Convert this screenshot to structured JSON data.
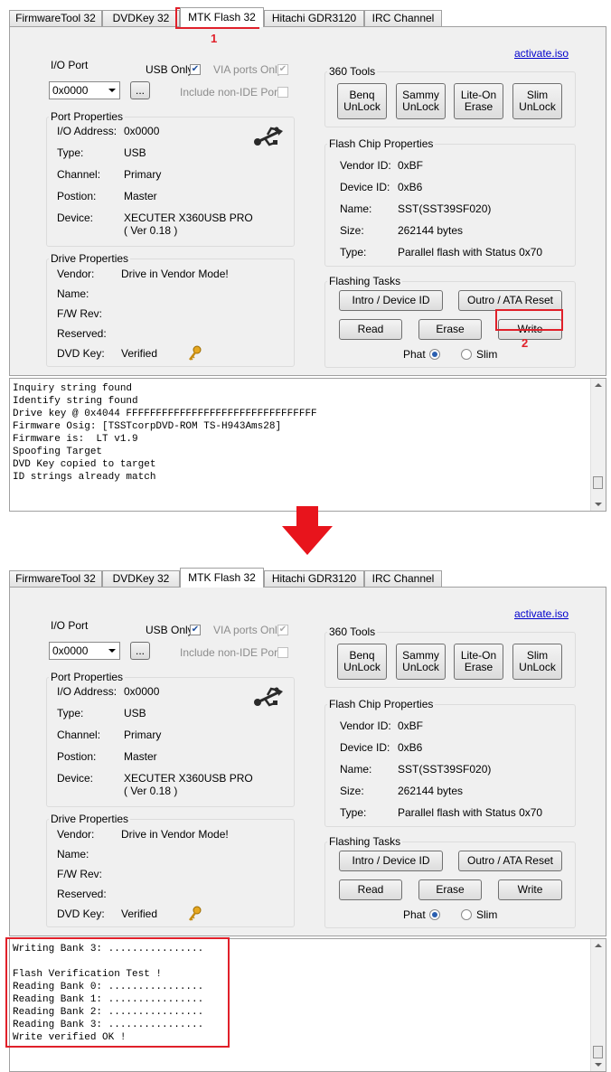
{
  "tabs": [
    "FirmwareTool 32",
    "DVDKey 32",
    "MTK Flash 32",
    "Hitachi GDR3120",
    "IRC Channel"
  ],
  "activate_link": "activate.iso",
  "io_port": {
    "label": "I/O Port",
    "value": "0x0000",
    "browse": "...",
    "usb_only": "USB Only",
    "via_only": "VIA ports Only",
    "non_ide": "Include non-IDE Ports"
  },
  "port_properties": {
    "title": "Port Properties",
    "rows": [
      {
        "label": "I/O Address:",
        "value": "0x0000"
      },
      {
        "label": "Type:",
        "value": "USB"
      },
      {
        "label": "Channel:",
        "value": "Primary"
      },
      {
        "label": "Postion:",
        "value": "Master"
      },
      {
        "label": "Device:",
        "value": "XECUTER X360USB PRO"
      }
    ],
    "device_version": "( Ver 0.18 )"
  },
  "drive_properties": {
    "title": "Drive Properties",
    "rows": [
      {
        "label": "Vendor:",
        "value": "Drive in Vendor Mode!"
      },
      {
        "label": "Name:",
        "value": ""
      },
      {
        "label": "F/W Rev:",
        "value": ""
      },
      {
        "label": "Reserved:",
        "value": ""
      },
      {
        "label": "DVD Key:",
        "value": "Verified"
      }
    ]
  },
  "tools360": {
    "title": "360 Tools",
    "buttons": [
      {
        "line1": "Benq",
        "line2": "UnLock"
      },
      {
        "line1": "Sammy",
        "line2": "UnLock"
      },
      {
        "line1": "Lite-On",
        "line2": "Erase"
      },
      {
        "line1": "Slim",
        "line2": "UnLock"
      }
    ]
  },
  "flash_chip": {
    "title": "Flash Chip Properties",
    "rows": [
      {
        "label": "Vendor ID:",
        "value": "0xBF"
      },
      {
        "label": "Device ID:",
        "value": "0xB6"
      },
      {
        "label": "Name:",
        "value": "SST(SST39SF020)"
      },
      {
        "label": "Size:",
        "value": "262144 bytes"
      },
      {
        "label": "Type:",
        "value": "Parallel flash with Status 0x70"
      }
    ]
  },
  "flashing": {
    "title": "Flashing Tasks",
    "intro": "Intro / Device ID",
    "outro": "Outro / ATA Reset",
    "read": "Read",
    "erase": "Erase",
    "write": "Write",
    "phat": "Phat",
    "slim": "Slim"
  },
  "log_before": [
    "Inquiry string found",
    "Identify string found",
    "Drive key @ 0x4044 FFFFFFFFFFFFFFFFFFFFFFFFFFFFFFFF",
    "Firmware Osig: [TSSTcorpDVD-ROM TS-H943Ams28]",
    "Firmware is:  LT v1.9",
    "Spoofing Target",
    "DVD Key copied to target",
    "ID strings already match"
  ],
  "log_after": [
    "Writing Bank 3: ................",
    "",
    "Flash Verification Test !",
    "Reading Bank 0: ................",
    "Reading Bank 1: ................",
    "Reading Bank 2: ................",
    "Reading Bank 3: ................",
    "Write verified OK !"
  ],
  "annotations": {
    "step1": "1",
    "step2": "2"
  },
  "colors": {
    "highlight": "#e0202a",
    "arrow": "#e8141c",
    "link": "#0000cc"
  }
}
